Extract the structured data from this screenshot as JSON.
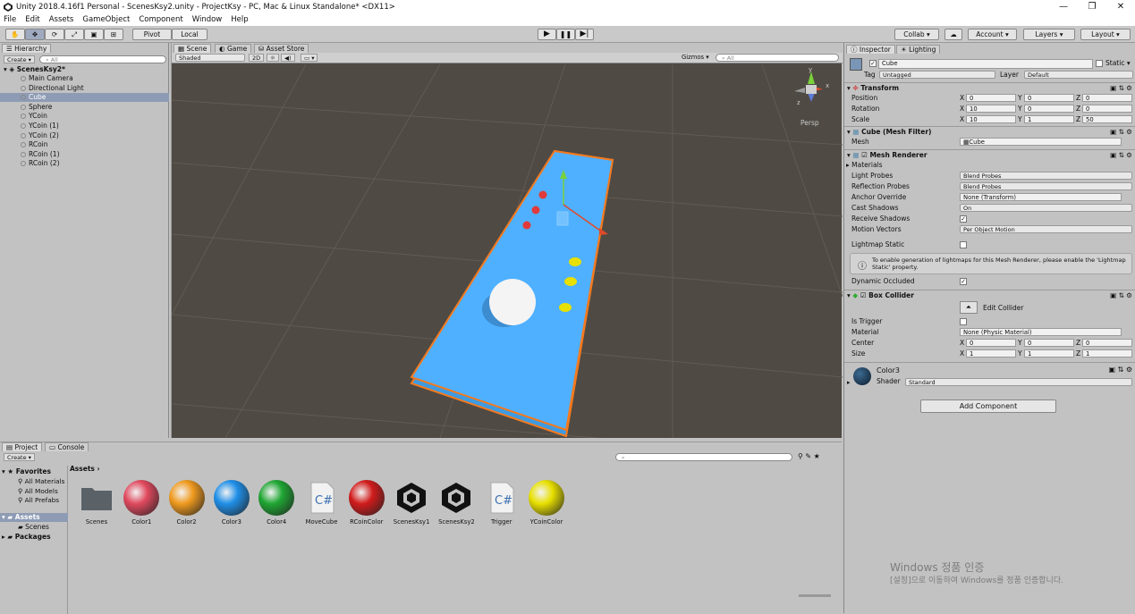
{
  "window": {
    "title": "Unity 2018.4.16f1 Personal - ScenesKsy2.unity - ProjectKsy - PC, Mac & Linux Standalone* <DX11>",
    "controls": [
      "—",
      "❐",
      "✕"
    ]
  },
  "menu": [
    "File",
    "Edit",
    "Assets",
    "GameObject",
    "Component",
    "Window",
    "Help"
  ],
  "toolbar": {
    "pivot": "Pivot",
    "local": "Local",
    "collab": "Collab ▾",
    "account": "Account",
    "layers": "Layers",
    "layout": "Layout"
  },
  "hierarchy": {
    "tab": "Hierarchy",
    "create": "Create ▾",
    "search_placeholder": "All",
    "scene": "ScenesKsy2*",
    "items": [
      "Main Camera",
      "Directional Light",
      "Cube",
      "Sphere",
      "YCoin",
      "YCoin (1)",
      "YCoin (2)",
      "RCoin",
      "RCoin (1)",
      "RCoin (2)"
    ],
    "selected_index": 2
  },
  "scene_tabs": [
    "Scene",
    "Game",
    "Asset Store"
  ],
  "scene_bar": {
    "shading": "Shaded",
    "mode2d": "2D",
    "gizmos": "Gizmos ▾",
    "search_placeholder": "All"
  },
  "scene_view": {
    "persp_label": "Persp",
    "gizmo_axes": {
      "y": "y",
      "x": "x",
      "z": "z"
    }
  },
  "inspector": {
    "tabs": [
      "Inspector",
      "Lighting"
    ],
    "object_name": "Cube",
    "static_label": "Static",
    "tag_label": "Tag",
    "tag_value": "Untagged",
    "layer_label": "Layer",
    "layer_value": "Default",
    "transform": {
      "title": "Transform",
      "position_label": "Position",
      "rotation_label": "Rotation",
      "scale_label": "Scale",
      "position": [
        "0",
        "0",
        "0"
      ],
      "rotation": [
        "10",
        "0",
        "0"
      ],
      "scale": [
        "10",
        "1",
        "50"
      ]
    },
    "mesh_filter": {
      "title": "Cube (Mesh Filter)",
      "mesh_label": "Mesh",
      "mesh_value": "Cube"
    },
    "mesh_renderer": {
      "title": "Mesh Renderer",
      "materials_label": "Materials",
      "rows": [
        {
          "label": "Light Probes",
          "value": "Blend Probes"
        },
        {
          "label": "Reflection Probes",
          "value": "Blend Probes"
        },
        {
          "label": "Anchor Override",
          "value": "None (Transform)"
        },
        {
          "label": "Cast Shadows",
          "value": "On"
        },
        {
          "label": "Receive Shadows",
          "value": ""
        },
        {
          "label": "Motion Vectors",
          "value": "Per Object Motion"
        }
      ],
      "lightmap_static": "Lightmap Static",
      "info": "To enable generation of lightmaps for this Mesh Renderer, please enable the 'Lightmap Static' property.",
      "dynamic_occluded": "Dynamic Occluded"
    },
    "box_collider": {
      "title": "Box Collider",
      "edit_collider": "Edit Collider",
      "is_trigger": "Is Trigger",
      "material_label": "Material",
      "material_value": "None (Physic Material)",
      "center_label": "Center",
      "size_label": "Size",
      "center": [
        "0",
        "0",
        "0"
      ],
      "size": [
        "1",
        "1",
        "1"
      ]
    },
    "material": {
      "name": "Color3",
      "shader_label": "Shader",
      "shader_value": "Standard"
    },
    "add_component": "Add Component"
  },
  "project": {
    "tabs": [
      "Project",
      "Console"
    ],
    "create": "Create ▾",
    "favorites": "Favorites",
    "fav_items": [
      "All Materials",
      "All Models",
      "All Prefabs"
    ],
    "assets_root": "Assets",
    "assets_children": [
      "Scenes"
    ],
    "packages": "Packages",
    "breadcrumb": "Assets",
    "assets": [
      {
        "name": "Scenes",
        "kind": "folder",
        "color": "#5a6268"
      },
      {
        "name": "Color1",
        "kind": "material",
        "color": "#e0495e"
      },
      {
        "name": "Color2",
        "kind": "material",
        "color": "#f09a1e"
      },
      {
        "name": "Color3",
        "kind": "material",
        "color": "#1f8fe8"
      },
      {
        "name": "Color4",
        "kind": "material",
        "color": "#1fa633"
      },
      {
        "name": "MoveCube",
        "kind": "script",
        "color": "#3c6fb0"
      },
      {
        "name": "RCoinColor",
        "kind": "material",
        "color": "#d11b1b"
      },
      {
        "name": "ScenesKsy1",
        "kind": "unity",
        "color": "#111111"
      },
      {
        "name": "ScenesKsy2",
        "kind": "unity",
        "color": "#111111"
      },
      {
        "name": "Trigger",
        "kind": "script",
        "color": "#3c6fb0"
      },
      {
        "name": "YCoinColor",
        "kind": "material",
        "color": "#e8e000"
      }
    ]
  },
  "watermark": {
    "line1": "Windows 정품 인증",
    "line2": "[설정]으로 이동하여 Windows를 정품 인증합니다."
  },
  "colors": {
    "plane": "#4fb0ff",
    "selection_outline": "#f47a1e",
    "scene_bg": "#4f4a44"
  }
}
